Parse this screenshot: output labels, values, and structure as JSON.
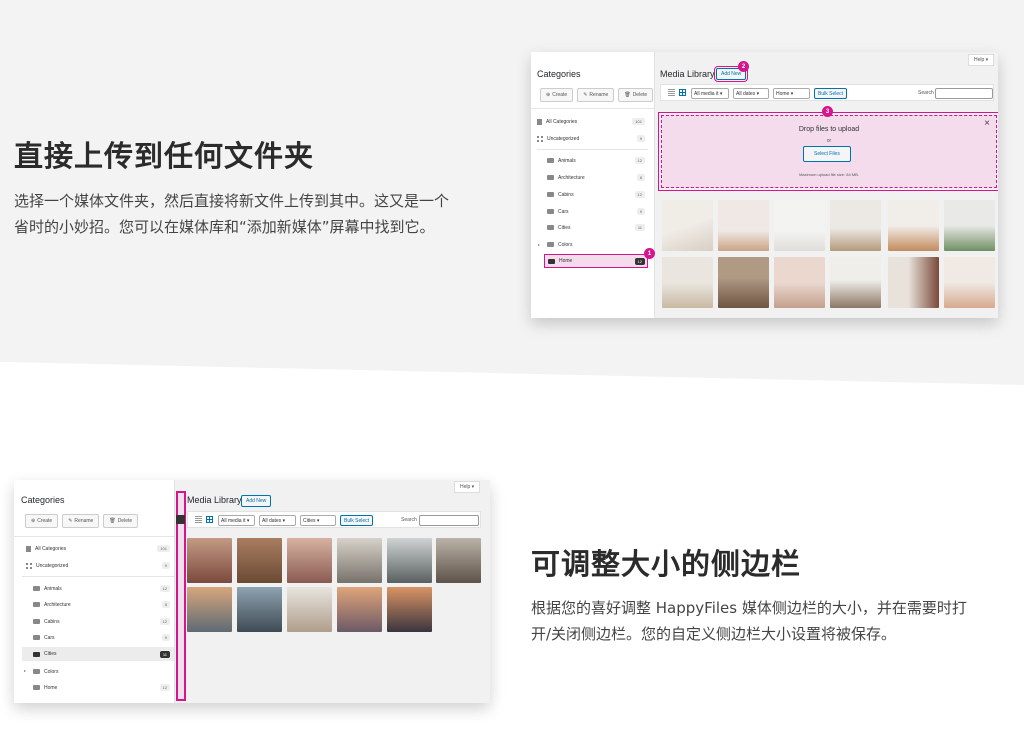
{
  "feature1": {
    "title": "直接上传到任何文件夹",
    "desc_line1": "选择一个媒体文件夹，然后直接将新文件上传到其中。这又是一个",
    "desc_line2": "省时的小妙招。您可以在媒体库和“添加新媒体”屏幕中找到它。"
  },
  "feature2": {
    "title": "可调整大小的侧边栏",
    "desc_line1": "根据您的喜好调整 HappyFiles 媒体侧边栏的大小，并在需要时打",
    "desc_line2": "开/关闭侧边栏。您的自定义侧边栏大小设置将被保存。"
  },
  "shot1": {
    "help": "Help ▾",
    "categories_title": "Categories",
    "btn_create": "Create",
    "btn_rename": "Rename",
    "btn_delete": "Delete",
    "all_categories": "All Categories",
    "all_count": "101",
    "uncategorized": "Uncategorized",
    "uncat_count": "9",
    "folders": [
      {
        "name": "Animals",
        "count": "12"
      },
      {
        "name": "Architecture",
        "count": "8"
      },
      {
        "name": "Cabins",
        "count": "12"
      },
      {
        "name": "Cars",
        "count": "9"
      },
      {
        "name": "Cities",
        "count": "11"
      },
      {
        "name": "Colors",
        "count": ""
      },
      {
        "name": "Home",
        "count": "12"
      }
    ],
    "media_library": "Media Library",
    "add_new": "Add New",
    "filter_media": "All media it ▾",
    "filter_dates": "All dates ▾",
    "filter_folder": "Home ▾",
    "bulk_select": "Bulk Select",
    "search_label": "Search",
    "drop_title": "Drop files to upload",
    "drop_or": "or",
    "select_files": "Select Files",
    "max_upload": "Maximum upload file size: 64 MB.",
    "close": "×",
    "badge1": "1",
    "badge2": "2",
    "badge3": "3"
  },
  "shot2": {
    "help": "Help ▾",
    "categories_title": "Categories",
    "btn_create": "Create",
    "btn_rename": "Rename",
    "btn_delete": "Delete",
    "all_categories": "All Categories",
    "all_count": "101",
    "uncategorized": "Uncategorized",
    "uncat_count": "9",
    "folders": [
      {
        "name": "Animals",
        "count": "12"
      },
      {
        "name": "Architecture",
        "count": "8"
      },
      {
        "name": "Cabins",
        "count": "12"
      },
      {
        "name": "Cars",
        "count": "9"
      },
      {
        "name": "Cities",
        "count": "11"
      },
      {
        "name": "Colors",
        "count": ""
      },
      {
        "name": "Home",
        "count": "12"
      }
    ],
    "media_library": "Media Library",
    "add_new": "Add New",
    "filter_media": "All media it ▾",
    "filter_dates": "All dates ▾",
    "filter_folder": "Cities ▾",
    "bulk_select": "Bulk Select",
    "search_label": "Search"
  },
  "colors": {
    "accent": "#d6148e",
    "link": "#0073aa"
  }
}
